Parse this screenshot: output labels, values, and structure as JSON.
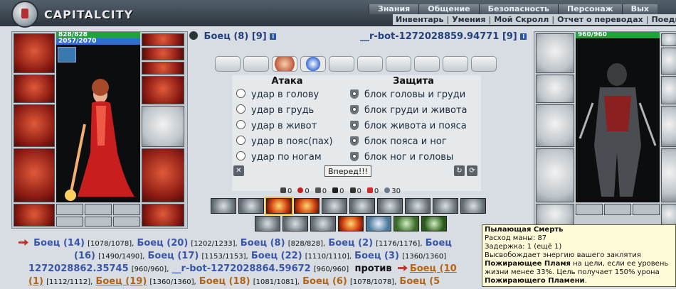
{
  "logo": {
    "text": "CAPITALCITY"
  },
  "menu_top": [
    "Знания",
    "Общение",
    "Безопасность",
    "Персонаж",
    "Вых"
  ],
  "menu_sub": [
    "Инвентарь",
    "Умения",
    "Мой Скролл",
    "Отчет о переводах",
    "Поединки"
  ],
  "player_left": {
    "hp": "828/828",
    "mana": "2057/2070"
  },
  "player_right": {
    "hp": "960/960"
  },
  "fight": {
    "me": {
      "name": "Боец (8)",
      "level": "[9]"
    },
    "opponent": {
      "name": "__r-bot-1272028859.94771",
      "level": "[9]"
    },
    "attack_title": "Атака",
    "defense_title": "Защита",
    "attack": [
      "удар в голову",
      "удар в грудь",
      "удар в живот",
      "удар в пояс(пах)",
      "удар по ногам"
    ],
    "defense": [
      "блок головы и груди",
      "блок груди и живота",
      "блок живота и пояса",
      "блок пояса и ног",
      "блок ног и головы"
    ],
    "go_button": "Вперед!!!",
    "stats": [
      "0",
      "0",
      "0",
      "0",
      "0",
      "0",
      "30"
    ]
  },
  "log": {
    "row1": [
      {
        "n": "Боец (14)",
        "h": "[1078/1078],"
      },
      {
        "n": "Боец (20)",
        "h": "[1202/1233],"
      },
      {
        "n": "Боец (8)",
        "h": "[828/828],"
      },
      {
        "n": "Боец (2)",
        "h": "[1176/1176],"
      },
      {
        "n": "Боец"
      }
    ],
    "row2": [
      {
        "n": "(16)",
        "h": "[1490/1490],"
      },
      {
        "n": "Боец (17)",
        "h": "[1153/1153],"
      },
      {
        "n": "Боец (22)",
        "h": "[1110/1110],"
      },
      {
        "n": "Боец (3)",
        "h": "[1360/1360]"
      }
    ],
    "row3": [
      {
        "n": "1272028862.35745",
        "h": "[960/960],"
      },
      {
        "n": "__r-bot-1272028864.59672",
        "h": "[960/960]"
      }
    ],
    "vs": "против",
    "enemy_first": "Боец (10",
    "row4": [
      {
        "n": "(1)",
        "h": "[1112/1112],"
      },
      {
        "n": "Боец (19)",
        "h": "[1360/1360],"
      },
      {
        "n": "Боец (18)",
        "h": "[1081/1081],"
      },
      {
        "n": "Боец (6)",
        "h": "[1078/1078],"
      },
      {
        "n": "Боец (5"
      }
    ]
  },
  "tooltip": {
    "title": "Пылающая Смерть",
    "mana": "Расход маны: 87",
    "delay": "Задержка: 1 (ещё 1)",
    "desc": "Высвобождает энергию вашего заклятия",
    "line1_bold": "Пожирающее Пламя",
    "line1_rest": " на цели, если ее уровень",
    "line2": "жизни менее 33%. Цель получает 150% урона",
    "line3_bold": "Пожирающего Пламени",
    "line3_rest": "."
  }
}
